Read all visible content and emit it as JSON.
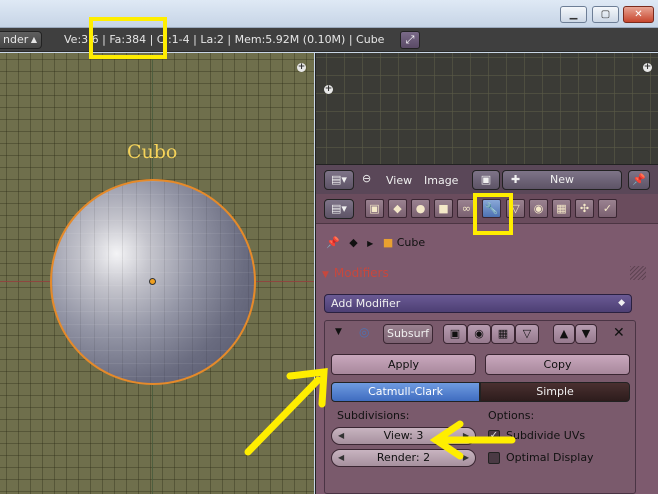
{
  "window": {
    "minimize_icon": "minimize-icon",
    "maximize_icon": "maximize-icon",
    "close_icon": "close-icon"
  },
  "infobar": {
    "render_engine": "nder",
    "stats": "Ve:3  6 | Fa:384 | C  :1-4 | La:2 | Mem:5.92M (0.10M) | Cube",
    "fullscreen_icon": "fullscreen-icon"
  },
  "viewport": {
    "object_annotation": "Cubo"
  },
  "uv_header": {
    "view_label": "View",
    "image_label": "Image",
    "new_label": "New"
  },
  "properties": {
    "breadcrumb_object": "Cube",
    "section_title": "Modifiers",
    "add_modifier_label": "Add Modifier",
    "modifier": {
      "name": "Subsurf",
      "apply_label": "Apply",
      "copy_label": "Copy",
      "type_options": [
        "Catmull-Clark",
        "Simple"
      ],
      "type_selected": "Catmull-Clark",
      "subdivisions_label": "Subdivisions:",
      "options_label": "Options:",
      "view_field": "View: 3",
      "render_field": "Render: 2",
      "subdivide_uvs_label": "Subdivide UVs",
      "subdivide_uvs_checked": true,
      "optimal_display_label": "Optimal Display",
      "optimal_display_checked": false
    }
  },
  "colors": {
    "highlight": "#ffee00",
    "selection_outline": "#e58a2a",
    "active_tab": "#4d72b2",
    "section_title": "#c7473d"
  }
}
